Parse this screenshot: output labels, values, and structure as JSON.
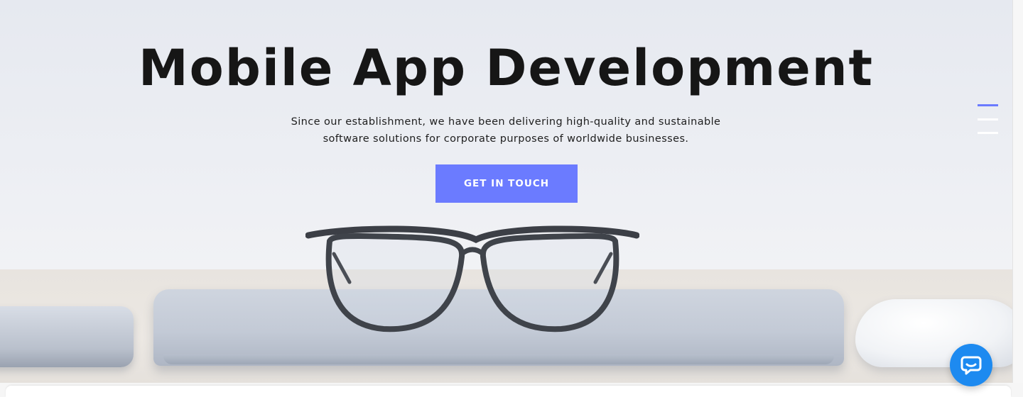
{
  "hero": {
    "title": "Mobile App Development",
    "subtitle_line1": "Since our establishment, we have been delivering high-quality and sustainable",
    "subtitle_line2": "software solutions for corporate purposes of worldwide businesses.",
    "cta_label": "GET IN TOUCH",
    "background_icon": "desk-workspace-photo"
  },
  "menu": {
    "icon": "hamburger-menu-icon",
    "bar_colors": [
      "#6b7bff",
      "#ffffff",
      "#ffffff"
    ]
  },
  "chat": {
    "icon": "chat-bubble-icon",
    "color": "#1d8af0"
  },
  "colors": {
    "accent": "#6b7bff",
    "title": "#161616",
    "text": "#1e1e1e"
  }
}
